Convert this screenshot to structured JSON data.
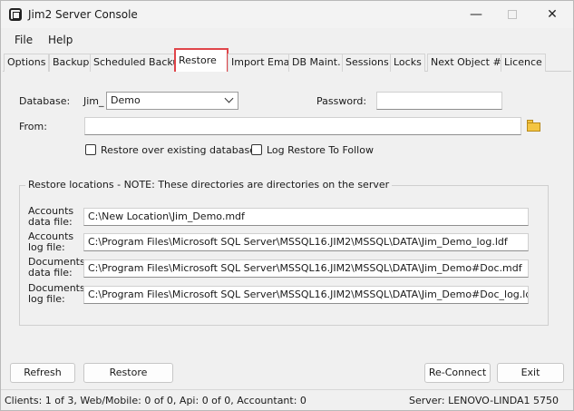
{
  "window": {
    "title": "Jim2 Server Console"
  },
  "menubar": {
    "file": "File",
    "help": "Help"
  },
  "tabs": [
    {
      "label": "Options"
    },
    {
      "label": "Backup"
    },
    {
      "label": "Scheduled Backup"
    },
    {
      "label": "Restore"
    },
    {
      "label": "Import Email"
    },
    {
      "label": "DB Maint."
    },
    {
      "label": "Sessions"
    },
    {
      "label": "Locks"
    },
    {
      "label": "Next Object #"
    },
    {
      "label": "Licence"
    }
  ],
  "restore": {
    "database_label": "Database:",
    "database_prefix": "Jim_",
    "database_value": "Demo",
    "password_label": "Password:",
    "password_value": "",
    "from_label": "From:",
    "from_value": "",
    "restore_over_existing_label": "Restore over existing database",
    "restore_over_existing_checked": false,
    "log_restore_label": "Log Restore To Follow",
    "log_restore_checked": false,
    "locations_title": "Restore locations - NOTE: These directories are directories on the server",
    "locations": [
      {
        "label": "Accounts data file:",
        "value": "C:\\New Location\\Jim_Demo.mdf"
      },
      {
        "label": "Accounts log file:",
        "value": "C:\\Program Files\\Microsoft SQL Server\\MSSQL16.JIM2\\MSSQL\\DATA\\Jim_Demo_log.ldf"
      },
      {
        "label": "Documents data file:",
        "value": "C:\\Program Files\\Microsoft SQL Server\\MSSQL16.JIM2\\MSSQL\\DATA\\Jim_Demo#Doc.mdf"
      },
      {
        "label": "Documents log file:",
        "value": "C:\\Program Files\\Microsoft SQL Server\\MSSQL16.JIM2\\MSSQL\\DATA\\Jim_Demo#Doc_log.ldf"
      }
    ]
  },
  "buttons": {
    "refresh": "Refresh",
    "restore": "Restore",
    "reconnect": "Re-Connect",
    "exit": "Exit"
  },
  "status": {
    "left": "Clients: 1 of 3, Web/Mobile: 0 of 0, Api: 0 of 0, Accountant: 0",
    "right": "Server: LENOVO-LINDA1 5750"
  },
  "colors": {
    "active_tab_outline": "#e0454a"
  }
}
